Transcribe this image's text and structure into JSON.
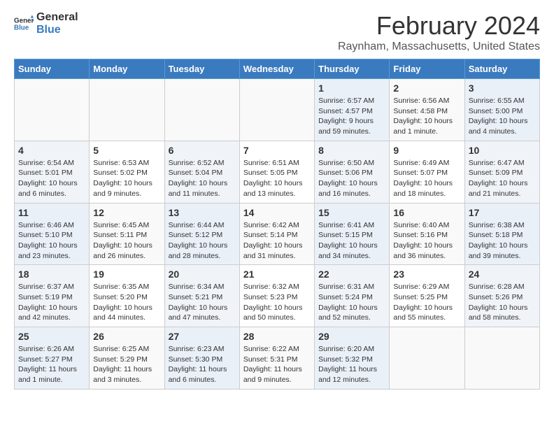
{
  "logo": {
    "text_general": "General",
    "text_blue": "Blue"
  },
  "title": "February 2024",
  "subtitle": "Raynham, Massachusetts, United States",
  "days_of_week": [
    "Sunday",
    "Monday",
    "Tuesday",
    "Wednesday",
    "Thursday",
    "Friday",
    "Saturday"
  ],
  "weeks": [
    [
      {
        "day": "",
        "info": ""
      },
      {
        "day": "",
        "info": ""
      },
      {
        "day": "",
        "info": ""
      },
      {
        "day": "",
        "info": ""
      },
      {
        "day": "1",
        "info": "Sunrise: 6:57 AM\nSunset: 4:57 PM\nDaylight: 9 hours\nand 59 minutes."
      },
      {
        "day": "2",
        "info": "Sunrise: 6:56 AM\nSunset: 4:58 PM\nDaylight: 10 hours\nand 1 minute."
      },
      {
        "day": "3",
        "info": "Sunrise: 6:55 AM\nSunset: 5:00 PM\nDaylight: 10 hours\nand 4 minutes."
      }
    ],
    [
      {
        "day": "4",
        "info": "Sunrise: 6:54 AM\nSunset: 5:01 PM\nDaylight: 10 hours\nand 6 minutes."
      },
      {
        "day": "5",
        "info": "Sunrise: 6:53 AM\nSunset: 5:02 PM\nDaylight: 10 hours\nand 9 minutes."
      },
      {
        "day": "6",
        "info": "Sunrise: 6:52 AM\nSunset: 5:04 PM\nDaylight: 10 hours\nand 11 minutes."
      },
      {
        "day": "7",
        "info": "Sunrise: 6:51 AM\nSunset: 5:05 PM\nDaylight: 10 hours\nand 13 minutes."
      },
      {
        "day": "8",
        "info": "Sunrise: 6:50 AM\nSunset: 5:06 PM\nDaylight: 10 hours\nand 16 minutes."
      },
      {
        "day": "9",
        "info": "Sunrise: 6:49 AM\nSunset: 5:07 PM\nDaylight: 10 hours\nand 18 minutes."
      },
      {
        "day": "10",
        "info": "Sunrise: 6:47 AM\nSunset: 5:09 PM\nDaylight: 10 hours\nand 21 minutes."
      }
    ],
    [
      {
        "day": "11",
        "info": "Sunrise: 6:46 AM\nSunset: 5:10 PM\nDaylight: 10 hours\nand 23 minutes."
      },
      {
        "day": "12",
        "info": "Sunrise: 6:45 AM\nSunset: 5:11 PM\nDaylight: 10 hours\nand 26 minutes."
      },
      {
        "day": "13",
        "info": "Sunrise: 6:44 AM\nSunset: 5:12 PM\nDaylight: 10 hours\nand 28 minutes."
      },
      {
        "day": "14",
        "info": "Sunrise: 6:42 AM\nSunset: 5:14 PM\nDaylight: 10 hours\nand 31 minutes."
      },
      {
        "day": "15",
        "info": "Sunrise: 6:41 AM\nSunset: 5:15 PM\nDaylight: 10 hours\nand 34 minutes."
      },
      {
        "day": "16",
        "info": "Sunrise: 6:40 AM\nSunset: 5:16 PM\nDaylight: 10 hours\nand 36 minutes."
      },
      {
        "day": "17",
        "info": "Sunrise: 6:38 AM\nSunset: 5:18 PM\nDaylight: 10 hours\nand 39 minutes."
      }
    ],
    [
      {
        "day": "18",
        "info": "Sunrise: 6:37 AM\nSunset: 5:19 PM\nDaylight: 10 hours\nand 42 minutes."
      },
      {
        "day": "19",
        "info": "Sunrise: 6:35 AM\nSunset: 5:20 PM\nDaylight: 10 hours\nand 44 minutes."
      },
      {
        "day": "20",
        "info": "Sunrise: 6:34 AM\nSunset: 5:21 PM\nDaylight: 10 hours\nand 47 minutes."
      },
      {
        "day": "21",
        "info": "Sunrise: 6:32 AM\nSunset: 5:23 PM\nDaylight: 10 hours\nand 50 minutes."
      },
      {
        "day": "22",
        "info": "Sunrise: 6:31 AM\nSunset: 5:24 PM\nDaylight: 10 hours\nand 52 minutes."
      },
      {
        "day": "23",
        "info": "Sunrise: 6:29 AM\nSunset: 5:25 PM\nDaylight: 10 hours\nand 55 minutes."
      },
      {
        "day": "24",
        "info": "Sunrise: 6:28 AM\nSunset: 5:26 PM\nDaylight: 10 hours\nand 58 minutes."
      }
    ],
    [
      {
        "day": "25",
        "info": "Sunrise: 6:26 AM\nSunset: 5:27 PM\nDaylight: 11 hours\nand 1 minute."
      },
      {
        "day": "26",
        "info": "Sunrise: 6:25 AM\nSunset: 5:29 PM\nDaylight: 11 hours\nand 3 minutes."
      },
      {
        "day": "27",
        "info": "Sunrise: 6:23 AM\nSunset: 5:30 PM\nDaylight: 11 hours\nand 6 minutes."
      },
      {
        "day": "28",
        "info": "Sunrise: 6:22 AM\nSunset: 5:31 PM\nDaylight: 11 hours\nand 9 minutes."
      },
      {
        "day": "29",
        "info": "Sunrise: 6:20 AM\nSunset: 5:32 PM\nDaylight: 11 hours\nand 12 minutes."
      },
      {
        "day": "",
        "info": ""
      },
      {
        "day": "",
        "info": ""
      }
    ]
  ]
}
